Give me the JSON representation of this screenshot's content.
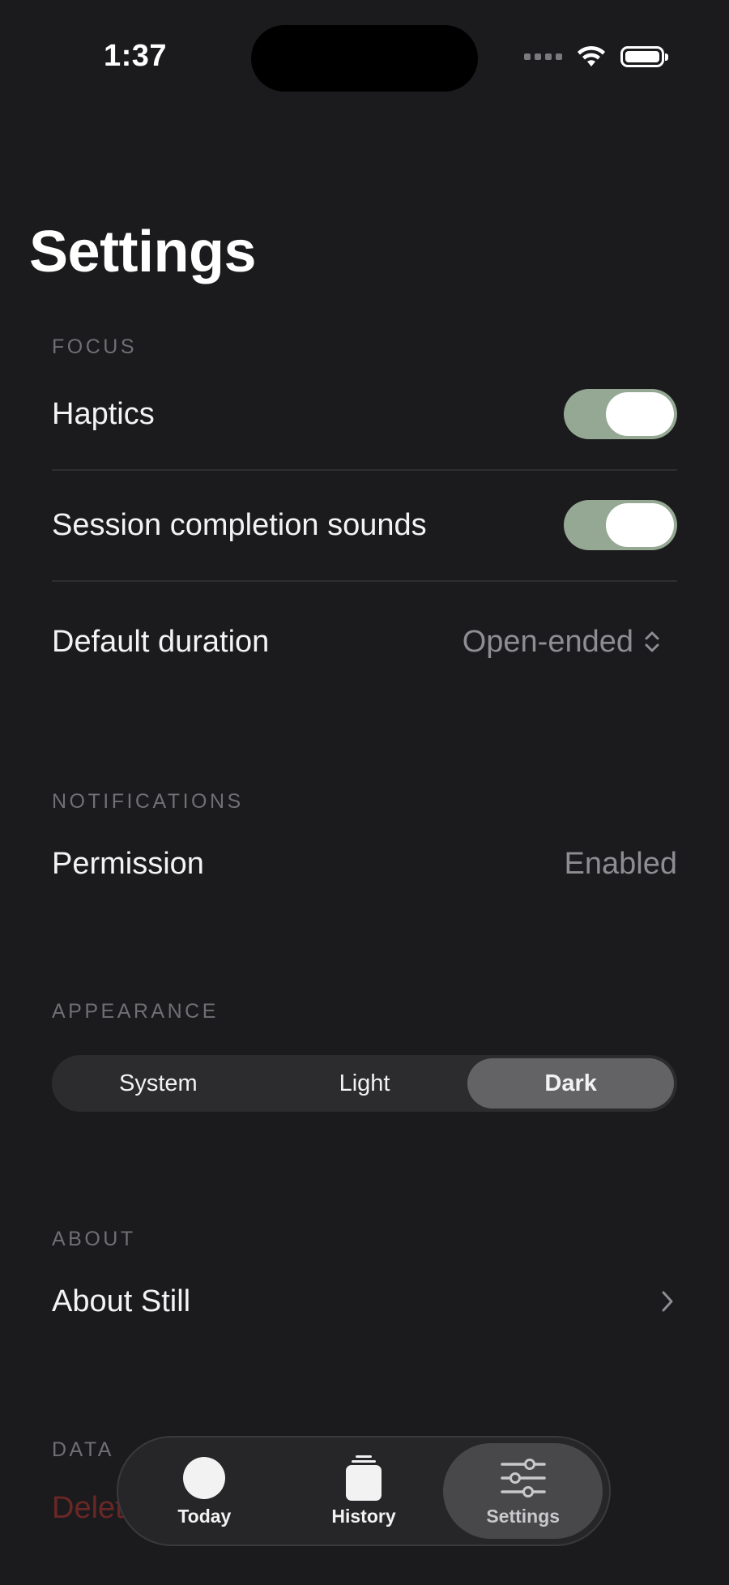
{
  "status_bar": {
    "time": "1:37"
  },
  "page": {
    "title": "Settings"
  },
  "focus": {
    "header": "FOCUS",
    "haptics_label": "Haptics",
    "haptics_on": true,
    "sounds_label": "Session completion sounds",
    "sounds_on": true,
    "duration_label": "Default duration",
    "duration_value": "Open-ended"
  },
  "notifications": {
    "header": "NOTIFICATIONS",
    "permission_label": "Permission",
    "permission_value": "Enabled"
  },
  "appearance": {
    "header": "APPEARANCE",
    "options": [
      "System",
      "Light",
      "Dark"
    ],
    "selected": "Dark"
  },
  "about": {
    "header": "ABOUT",
    "about_label": "About Still"
  },
  "data_section": {
    "header": "DATA",
    "delete_label": "Delete all session data"
  },
  "tab_bar": {
    "tabs": [
      {
        "label": "Today",
        "icon": "circle-icon"
      },
      {
        "label": "History",
        "icon": "stack-icon"
      },
      {
        "label": "Settings",
        "icon": "sliders-icon"
      }
    ],
    "selected": "Settings"
  },
  "colors": {
    "background": "#1b1b1d",
    "toggle_on": "#94a893",
    "destructive": "#6b2626",
    "secondary_text": "#8d8d92"
  }
}
